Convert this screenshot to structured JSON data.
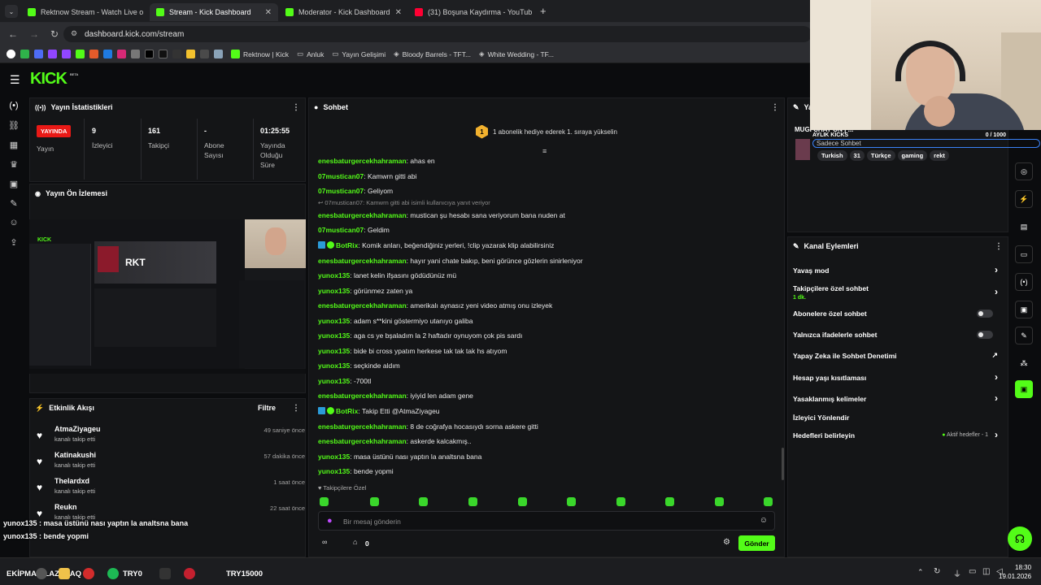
{
  "browser": {
    "tabs": [
      {
        "title": "Rektnow Stream - Watch Live o"
      },
      {
        "title": "Stream - Kick Dashboard"
      },
      {
        "title": "Moderator - Kick Dashboard"
      },
      {
        "title": "(31) Boşuna Kaydırma - YouTub"
      }
    ],
    "url": "dashboard.kick.com/stream",
    "bookmarks": [
      "Rektnow | Kick",
      "Anluk",
      "Yayın Gelişimi",
      "Bloody Barrels - TFT...",
      "White Wedding - TF..."
    ]
  },
  "app": {
    "logo": "KICK",
    "logo_beta": "BETA"
  },
  "stats": {
    "title": "Yayın İstatistikleri",
    "live_badge": "YAYINDA",
    "live_label": "Yayın",
    "viewers_value": "9",
    "viewers_label": "İzleyici",
    "followers_value": "161",
    "followers_label": "Takipçi",
    "subs_value": "-",
    "subs_label_1": "Abone",
    "subs_label_2": "Sayısı",
    "uptime_value": "01:25:55",
    "uptime_label_1": "Yayında",
    "uptime_label_2": "Olduğu",
    "uptime_label_3": "Süre"
  },
  "preview": {
    "title": "Yayın Ön İzlemesi",
    "inner_text": "RKT",
    "inner_logo": "KICK"
  },
  "activity": {
    "title": "Etkinlik Akışı",
    "filter": "Filtre",
    "items": [
      {
        "name": "AtmaZiyageu",
        "sub": "kanalı takip etti",
        "time": "49 saniye önce"
      },
      {
        "name": "Katinakushi",
        "sub": "kanalı takip etti",
        "time": "57 dakika önce"
      },
      {
        "name": "Thelardxd",
        "sub": "kanalı takip etti",
        "time": "1 saat önce"
      },
      {
        "name": "Reukn",
        "sub": "kanalı takip etti",
        "time": "22 saat önce"
      }
    ]
  },
  "overlay": {
    "line1": "yunox135 : masa üstünü nası yaptın la analtsna bana",
    "line2": "yunox135 : bende yopmi",
    "bottom_left": "EKİPMAN LAZIM AQ",
    "try0": "TRY0",
    "try15000": "TRY15000"
  },
  "chat": {
    "title": "Sohbet",
    "banner_number": "1",
    "banner_text": "1 abonelik hediye ederek 1. sıraya yükselin",
    "messages": [
      {
        "user": "enesbaturgercekhahraman",
        "text": "ahas en"
      },
      {
        "user": "07mustican07",
        "text": "Kamwrn gitti abi"
      },
      {
        "user": "07mustican07",
        "text": "Geliyom"
      },
      {
        "reply": "07mustican07: Kamwrn gitti abi isimli kullanıcıya yanıt veriyor",
        "user": "enesbaturgercekhahraman",
        "text": "mustican şu hesabı sana veriyorum bana nuden at"
      },
      {
        "user": "07mustican07",
        "text": "Geldim"
      },
      {
        "user": "BotRix",
        "bot": true,
        "text": "Komik anları, beğendiğiniz yerleri, !clip yazarak klip alabilirsiniz"
      },
      {
        "user": "enesbaturgercekhahraman",
        "text": "hayır yani chate bakıp, beni görünce gözlerin sinirleniyor"
      },
      {
        "user": "yunox135",
        "text": "lanet kelin ifşasını gödüdünüz mü"
      },
      {
        "user": "yunox135",
        "text": "görünmez zaten ya"
      },
      {
        "user": "enesbaturgercekhahraman",
        "text": "amerikalı aynasız yeni video atmış onu izleyek"
      },
      {
        "user": "yunox135",
        "text": "adam s**kini göstermiyo utanıyo galiba"
      },
      {
        "user": "yunox135",
        "text": "aga cs ye bşaladım la 2 haftadır oynuyom çok pis sardı"
      },
      {
        "user": "yunox135",
        "text": "bide bi cross ypatım herkese tak tak tak hs atıyom"
      },
      {
        "user": "yunox135",
        "text": "seçkinde aldım"
      },
      {
        "user": "yunox135",
        "text": "-700tl"
      },
      {
        "user": "enesbaturgercekhahraman",
        "text": "iyiyid len adam gene"
      },
      {
        "user": "BotRix",
        "bot": true,
        "text": "Takip Etti @AtmaZiyageu"
      },
      {
        "user": "enesbaturgercekhahraman",
        "text": "8 de coğrafya hocasıydı sorna askere gitti"
      },
      {
        "user": "enesbaturgercekhahraman",
        "text": "askerde kalcakmış.."
      },
      {
        "user": "yunox135",
        "text": "masa üstünü nası yaptın la analtsna bana"
      },
      {
        "user": "yunox135",
        "text": "bende yopmi"
      }
    ],
    "followers_only": "Takipçilere Özel",
    "input_placeholder": "Bir mesaj gönderin",
    "points_value": "0",
    "send_label": "Gönder"
  },
  "stream_info": {
    "title_partial": "Ya",
    "stream_title": "MUGI CHAT ON | ...",
    "monthly_kicks": "AYLIK KICKS",
    "kicks_value": "0 / 1000",
    "category": "Sadece Sohbet",
    "tags": [
      "Turkish",
      "31",
      "Türkçe",
      "gaming",
      "rekt"
    ]
  },
  "channel_actions": {
    "title": "Kanal Eylemleri",
    "slow_mode": "Yavaş mod",
    "followers_chat": "Takipçilere özel sohbet",
    "followers_chat_sub": "1 dk.",
    "subs_chat": "Abonelere özel sohbet",
    "emote_chat": "Yalnızca ifadelerle sohbet",
    "ai_moderation": "Yapay Zeka ile Sohbet Denetimi",
    "age_restriction": "Hesap yaşı kısıtlaması",
    "banned_words": "Yasaklanmış kelimeler",
    "redirect": "İzleyici Yönlendir",
    "goals": "Hedefleri belirleyin",
    "goals_status": "Aktif hedefler - 1"
  },
  "taskbar": {
    "time": "18:30",
    "date": "19.01.2026"
  },
  "colors": {
    "accent": "#53fc18",
    "live": "#e91916",
    "panel": "#141517",
    "bg": "#0b0c0e"
  }
}
